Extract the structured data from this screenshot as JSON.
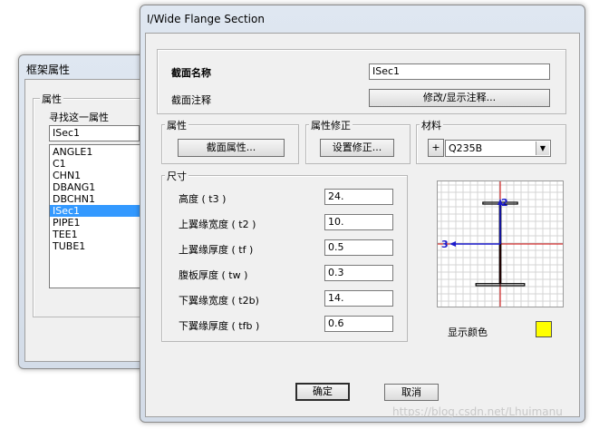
{
  "back_window": {
    "title": "框架属性",
    "group_label": "属性",
    "find_label": "寻找这一属性",
    "search_value": "ISec1",
    "list_items": [
      "ANGLE1",
      "C1",
      "CHN1",
      "DBANG1",
      "DBCHN1",
      "ISec1",
      "PIPE1",
      "TEE1",
      "TUBE1"
    ],
    "selected_index": 5
  },
  "dialog": {
    "title": "I/Wide Flange Section",
    "section_name_label": "截面名称",
    "section_name_value": "ISec1",
    "section_notes_label": "截面注释",
    "modify_notes_button": "修改/显示注释...",
    "properties_group": "属性",
    "section_properties_button": "截面属性...",
    "modifiers_group": "属性修正",
    "set_modifiers_button": "设置修正...",
    "material_group": "材料",
    "material_add_button": "+",
    "material_value": "Q235B",
    "dimensions_group": "尺寸",
    "dimensions": [
      {
        "label": "高度 ( t3 )",
        "value": "24."
      },
      {
        "label": "上翼缘宽度 ( t2 )",
        "value": "10."
      },
      {
        "label": "上翼缘厚度 ( tf )",
        "value": "0.5"
      },
      {
        "label": "腹板厚度 ( tw )",
        "value": "0.3"
      },
      {
        "label": "下翼缘宽度 ( t2b)",
        "value": "14."
      },
      {
        "label": "下翼缘厚度 ( tfb )",
        "value": "0.6"
      }
    ],
    "preview": {
      "axis_2_label": "2",
      "axis_3_label": "3"
    },
    "display_color_label": "显示颜色",
    "display_color": "#ffff00",
    "ok_button": "确定",
    "cancel_button": "取消"
  },
  "watermark": "https://blog.csdn.net/Lhuimanu",
  "colors": {
    "selection": "#3399ff",
    "axis_red": "#cc0000",
    "axis_blue": "#1a1acc",
    "section_outline": "#000000"
  }
}
